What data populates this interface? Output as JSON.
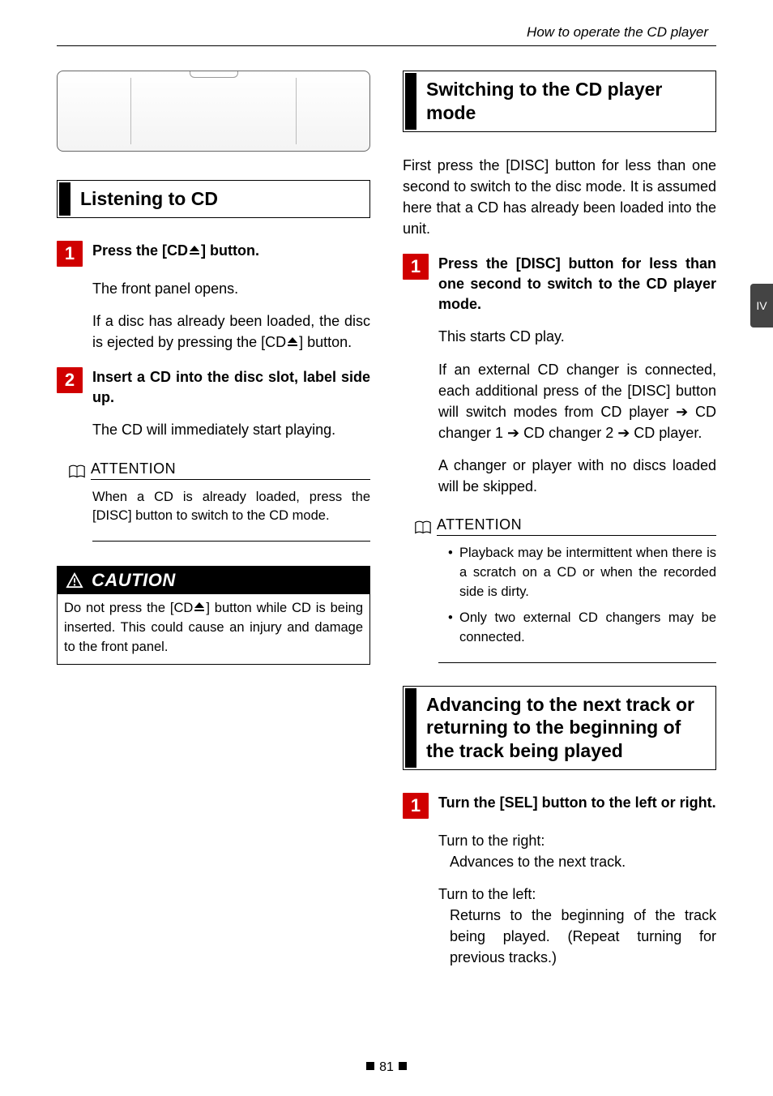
{
  "header": {
    "title": "How to operate the CD player"
  },
  "side_tab": "IV",
  "page_number": "81",
  "icons": {
    "eject": "eject-icon",
    "book": "book-open-icon",
    "warn_triangle": "warning-triangle-icon"
  },
  "left": {
    "section1": {
      "title": "Listening to CD"
    },
    "step1": {
      "num": "1",
      "title_pre": "Press the [CD",
      "title_post": "] button.",
      "p1": "The front panel opens.",
      "p2_pre": "If a disc has already been loaded, the disc is ejected by pressing the [CD",
      "p2_post": "] button."
    },
    "step2": {
      "num": "2",
      "title": "Insert a CD into the disc slot, label side up.",
      "p1": "The CD will immediately start playing."
    },
    "attention": {
      "label": "ATTENTION",
      "text": "When a CD is already loaded, press the [DISC] button to switch to the CD mode."
    },
    "caution": {
      "label": "CAUTION",
      "body_pre": "Do not press the [CD",
      "body_post": "] button while CD is being inserted. This could cause an injury and damage to the front panel."
    }
  },
  "right": {
    "section1": {
      "title": "Switching to the CD player mode"
    },
    "intro": "First press the [DISC] button for less than one second to switch to the disc mode. It is assumed here that a CD has already been loaded into the unit.",
    "step1": {
      "num": "1",
      "title": "Press the [DISC] button for less than one second to switch to the CD player mode.",
      "p1": "This starts CD play.",
      "p2": "If an external CD changer is connected, each additional press of the [DISC] button will switch modes from CD player ➔ CD changer 1 ➔ CD changer 2 ➔ CD player.",
      "p3": "A changer or player with no discs loaded will be skipped."
    },
    "attention": {
      "label": "ATTENTION",
      "b1": "Playback may be intermittent when there is a scratch on a CD or when the recorded side is dirty.",
      "b2": "Only two external CD changers may be connected."
    },
    "section2": {
      "title": "Advancing to the next track or returning to the beginning of the track being played"
    },
    "step2": {
      "num": "1",
      "title": "Turn the [SEL] button to the left or right.",
      "right_lead": "Turn to the right:",
      "right_desc": "Advances to the next track.",
      "left_lead": "Turn to the left:",
      "left_desc": "Returns to the beginning of the track being played. (Repeat turning for previous tracks.)"
    }
  }
}
